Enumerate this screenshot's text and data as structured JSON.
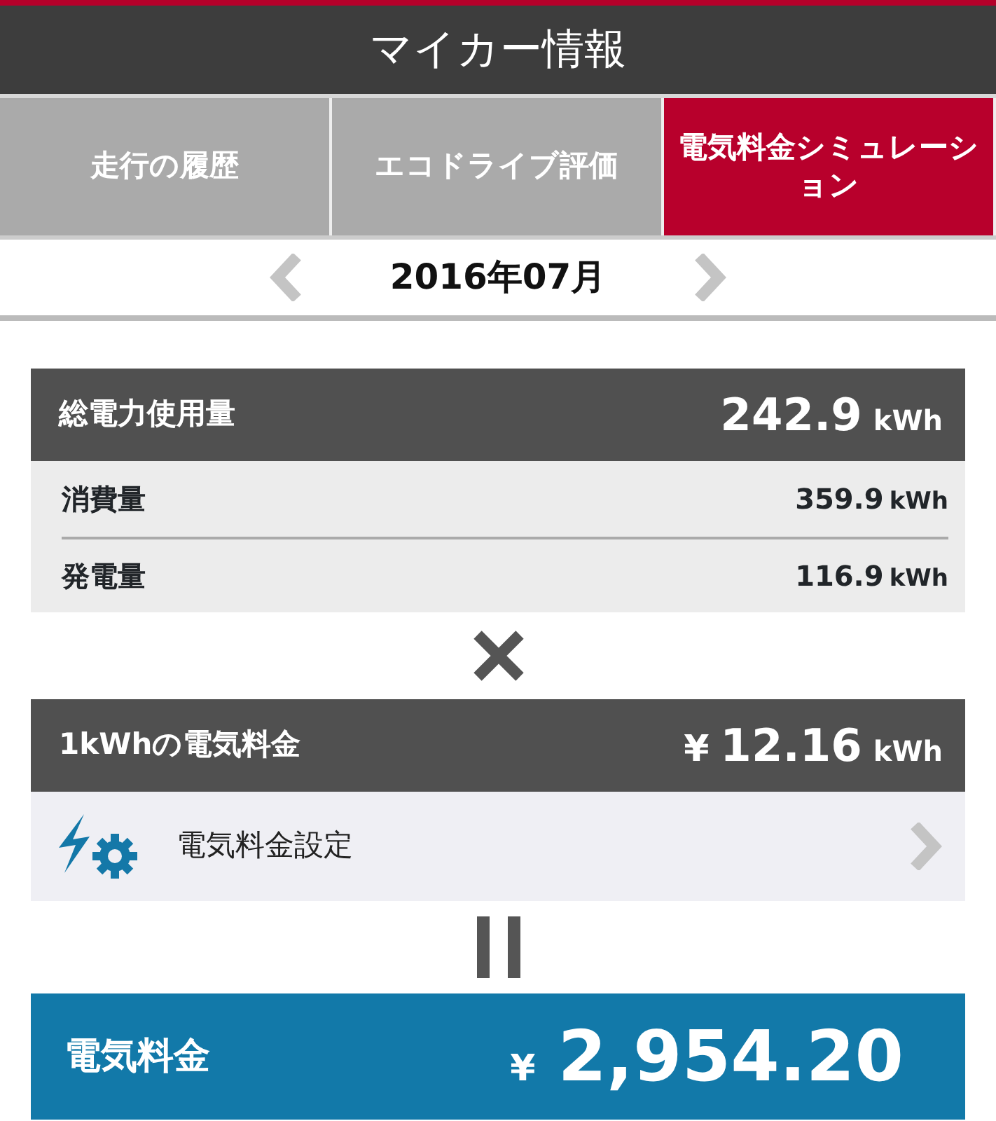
{
  "header": {
    "title": "マイカー情報"
  },
  "tabs": [
    {
      "label": "走行の履歴",
      "selected": false
    },
    {
      "label": "エコドライブ評価",
      "selected": false
    },
    {
      "label": "電気料金シミュレーション",
      "selected": true
    }
  ],
  "month": "2016年07月",
  "total": {
    "label": "総電力使用量",
    "value": "242.9",
    "unit": "kWh",
    "rows": [
      {
        "label": "消費量",
        "value": "359.9",
        "unit": "kWh"
      },
      {
        "label": "発電量",
        "value": "116.9",
        "unit": "kWh"
      }
    ]
  },
  "rate": {
    "label": "1kWhの電気料金",
    "currency": "¥",
    "value": "12.16",
    "unit": "kWh"
  },
  "setting": {
    "label": "電気料金設定"
  },
  "result": {
    "label": "電気料金",
    "currency": "¥",
    "value": "2,954.20"
  }
}
